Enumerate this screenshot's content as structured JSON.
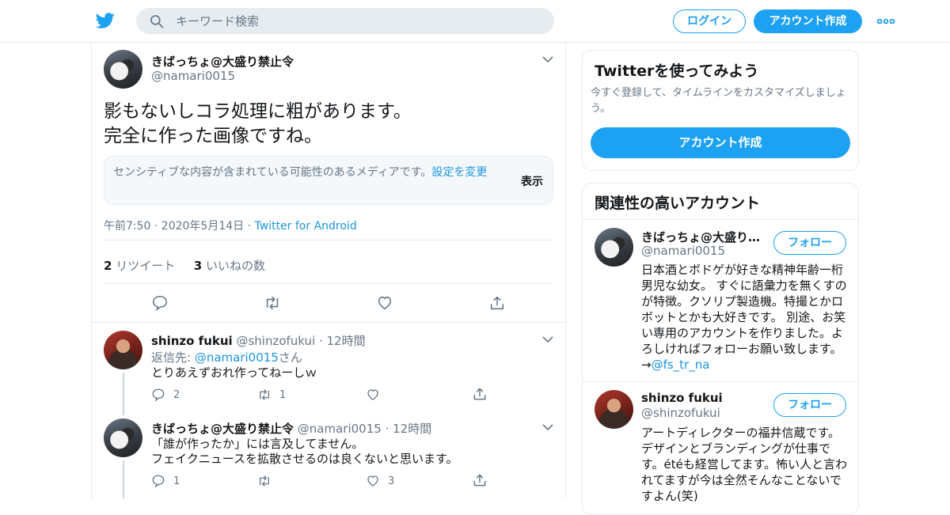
{
  "colors": {
    "accent": "#1da1f2",
    "link": "#1b95e0",
    "muted": "#657786",
    "text": "#14171a",
    "border": "#e6ecf0"
  },
  "header": {
    "logo_icon": "twitter-bird-icon",
    "search_placeholder": "キーワード検索",
    "login_label": "ログイン",
    "signup_label": "アカウント作成",
    "more_icon": "more-dots-icon"
  },
  "tweet": {
    "author_name": "きばっちょ@大盛り禁止令",
    "author_handle": "@namari0015",
    "text_line1": "影もないしコラ処理に粗があります。",
    "text_line2": "完全に作った画像ですね。",
    "sensitive_message": "センシティブな内容が含まれている可能性のあるメディアです。",
    "sensitive_link": "設定を変更",
    "show_label": "表示",
    "time": "午前7:50 · 2020年5月14日 · ",
    "client": "Twitter for Android",
    "retweet_count": "2",
    "retweet_label": " リツイート",
    "like_count": "3",
    "like_label": " いいねの数"
  },
  "replies": [
    {
      "name": "shinzo fukui",
      "handle": "@shinzofukui",
      "time": " · 12時間",
      "reply_prefix": "返信先: ",
      "reply_mention": "@namari0015",
      "reply_suffix": "さん",
      "text": "とりあえずおれ作ってねーしｗ",
      "replies": "2",
      "retweets": "1",
      "likes": ""
    },
    {
      "name": "きばっちょ@大盛り禁止令",
      "handle": "@namari0015",
      "time": " · 12時間",
      "text_line1": "「誰が作ったか」には言及してません。",
      "text_line2": "フェイクニュースを拡散させるのは良くないと思います。",
      "replies": "1",
      "retweets": "",
      "likes": "3"
    }
  ],
  "sidebar": {
    "signup_card": {
      "title": "Twitterを使ってみよう",
      "subtitle": "今すぐ登録して、タイムラインをカスタマイズしましょう。",
      "button": "アカウント作成"
    },
    "related": {
      "title": "関連性の高いアカウント",
      "accounts": [
        {
          "name": "きばっちょ@大盛り…",
          "handle": "@namari0015",
          "follow": "フォロー",
          "bio": "日本酒とボドゲが好きな精神年齢一桁男児な幼女。 すぐに語彙力を無くすのが特徴。クソリプ製造機。特撮とかロボットとかも大好きです。 別途、お笑い専用のアカウントを作りました。よろしければフォローお願い致します。→",
          "bio_link": "@fs_tr_na"
        },
        {
          "name": "shinzo fukui",
          "handle": "@shinzofukui",
          "follow": "フォロー",
          "bio": "アートディレクターの福井信蔵です。デザインとブランディングが仕事です。étéも経営してます。怖い人と言われてますが今は全然そんなことないですよん(笑)"
        }
      ]
    }
  }
}
